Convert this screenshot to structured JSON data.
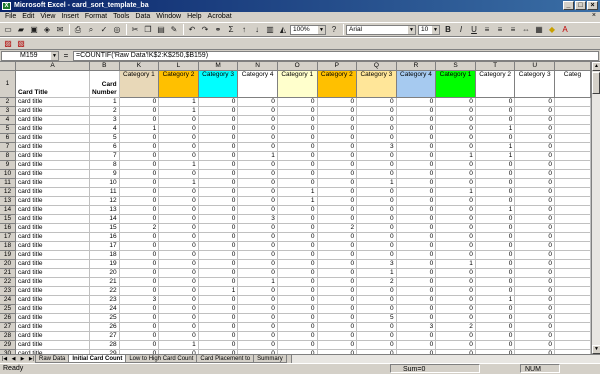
{
  "window": {
    "title": "Microsoft Excel - card_sort_template_ba"
  },
  "menu": [
    "File",
    "Edit",
    "View",
    "Insert",
    "Format",
    "Tools",
    "Data",
    "Window",
    "Help",
    "Acrobat"
  ],
  "toolbar": {
    "zoom": "100%",
    "font": "Arial",
    "font_size": "10"
  },
  "formula_bar": {
    "name_box": "M159",
    "formula": "=COUNTIF('Raw Data'!K$2:K$250,$B159)"
  },
  "columns": [
    "A",
    "B",
    "K",
    "L",
    "M",
    "N",
    "O",
    "P",
    "Q",
    "R",
    "S",
    "T",
    "U",
    ""
  ],
  "header_row": {
    "card_title": "Card Title",
    "card_number": "Card Number",
    "categories": [
      {
        "label": "Category 1",
        "color": "#e8d8b8"
      },
      {
        "label": "Category 2",
        "color": "#ffc000"
      },
      {
        "label": "Category 3",
        "color": "#00ffff"
      },
      {
        "label": "Category 4",
        "color": "#ffffff"
      },
      {
        "label": "Category 1",
        "color": "#ffffcc"
      },
      {
        "label": "Category 2",
        "color": "#ffc000"
      },
      {
        "label": "Category 3",
        "color": "#ffe699"
      },
      {
        "label": "Category 4",
        "color": "#a6caf0"
      },
      {
        "label": "Category 1",
        "color": "#00ff00"
      },
      {
        "label": "Category 2",
        "color": "#ffffff"
      },
      {
        "label": "Category 3",
        "color": "#ffffff"
      },
      {
        "label": "Categ",
        "color": "#ffffff"
      }
    ]
  },
  "rows": [
    {
      "n": "2",
      "title": "card title",
      "num": "1",
      "v": [
        "0",
        "1",
        "0",
        "0",
        "0",
        "0",
        "0",
        "0",
        "0",
        "0",
        "0",
        ""
      ]
    },
    {
      "n": "3",
      "title": "card title",
      "num": "2",
      "v": [
        "0",
        "1",
        "0",
        "0",
        "0",
        "0",
        "0",
        "0",
        "0",
        "0",
        "0",
        ""
      ]
    },
    {
      "n": "4",
      "title": "card title",
      "num": "3",
      "v": [
        "0",
        "0",
        "0",
        "0",
        "0",
        "0",
        "0",
        "0",
        "0",
        "0",
        "0",
        ""
      ]
    },
    {
      "n": "5",
      "title": "card title",
      "num": "4",
      "v": [
        "1",
        "0",
        "0",
        "0",
        "0",
        "0",
        "0",
        "0",
        "0",
        "1",
        "0",
        ""
      ]
    },
    {
      "n": "6",
      "title": "card title",
      "num": "5",
      "v": [
        "0",
        "0",
        "0",
        "0",
        "0",
        "0",
        "0",
        "0",
        "0",
        "0",
        "0",
        ""
      ]
    },
    {
      "n": "7",
      "title": "card title",
      "num": "6",
      "v": [
        "0",
        "0",
        "0",
        "0",
        "0",
        "0",
        "3",
        "0",
        "0",
        "1",
        "0",
        ""
      ]
    },
    {
      "n": "8",
      "title": "card title",
      "num": "7",
      "v": [
        "0",
        "0",
        "0",
        "1",
        "0",
        "0",
        "0",
        "0",
        "1",
        "1",
        "0",
        ""
      ]
    },
    {
      "n": "9",
      "title": "card title",
      "num": "8",
      "v": [
        "0",
        "1",
        "0",
        "0",
        "0",
        "0",
        "0",
        "0",
        "0",
        "0",
        "0",
        ""
      ]
    },
    {
      "n": "10",
      "title": "card title",
      "num": "9",
      "v": [
        "0",
        "0",
        "0",
        "0",
        "0",
        "0",
        "0",
        "0",
        "0",
        "0",
        "0",
        ""
      ]
    },
    {
      "n": "11",
      "title": "card title",
      "num": "10",
      "v": [
        "0",
        "1",
        "0",
        "0",
        "0",
        "0",
        "1",
        "0",
        "0",
        "0",
        "0",
        ""
      ]
    },
    {
      "n": "12",
      "title": "card title",
      "num": "11",
      "v": [
        "0",
        "0",
        "0",
        "0",
        "1",
        "0",
        "0",
        "0",
        "1",
        "0",
        "0",
        ""
      ]
    },
    {
      "n": "13",
      "title": "card title",
      "num": "12",
      "v": [
        "0",
        "0",
        "0",
        "0",
        "1",
        "0",
        "0",
        "0",
        "0",
        "0",
        "0",
        ""
      ]
    },
    {
      "n": "14",
      "title": "card title",
      "num": "13",
      "v": [
        "0",
        "0",
        "0",
        "0",
        "0",
        "0",
        "0",
        "0",
        "0",
        "1",
        "0",
        ""
      ]
    },
    {
      "n": "15",
      "title": "card title",
      "num": "14",
      "v": [
        "0",
        "0",
        "0",
        "3",
        "0",
        "0",
        "0",
        "0",
        "0",
        "0",
        "0",
        ""
      ]
    },
    {
      "n": "16",
      "title": "card title",
      "num": "15",
      "v": [
        "2",
        "0",
        "0",
        "0",
        "0",
        "2",
        "0",
        "0",
        "0",
        "0",
        "0",
        ""
      ]
    },
    {
      "n": "17",
      "title": "card title",
      "num": "16",
      "v": [
        "0",
        "0",
        "0",
        "0",
        "0",
        "0",
        "0",
        "0",
        "0",
        "0",
        "0",
        ""
      ]
    },
    {
      "n": "18",
      "title": "card title",
      "num": "17",
      "v": [
        "0",
        "0",
        "0",
        "0",
        "0",
        "0",
        "0",
        "0",
        "0",
        "0",
        "0",
        ""
      ]
    },
    {
      "n": "19",
      "title": "card title",
      "num": "18",
      "v": [
        "0",
        "0",
        "0",
        "0",
        "0",
        "0",
        "0",
        "0",
        "0",
        "0",
        "0",
        ""
      ]
    },
    {
      "n": "20",
      "title": "card title",
      "num": "19",
      "v": [
        "0",
        "0",
        "0",
        "0",
        "0",
        "0",
        "3",
        "0",
        "1",
        "0",
        "0",
        ""
      ]
    },
    {
      "n": "21",
      "title": "card title",
      "num": "20",
      "v": [
        "0",
        "0",
        "0",
        "0",
        "0",
        "0",
        "1",
        "0",
        "0",
        "0",
        "0",
        ""
      ]
    },
    {
      "n": "22",
      "title": "card title",
      "num": "21",
      "v": [
        "0",
        "0",
        "0",
        "1",
        "0",
        "0",
        "2",
        "0",
        "0",
        "0",
        "0",
        ""
      ]
    },
    {
      "n": "23",
      "title": "card title",
      "num": "22",
      "v": [
        "0",
        "0",
        "1",
        "0",
        "0",
        "0",
        "0",
        "0",
        "0",
        "0",
        "0",
        ""
      ]
    },
    {
      "n": "24",
      "title": "card title",
      "num": "23",
      "v": [
        "3",
        "0",
        "0",
        "0",
        "0",
        "0",
        "0",
        "0",
        "0",
        "1",
        "0",
        ""
      ]
    },
    {
      "n": "25",
      "title": "card title",
      "num": "24",
      "v": [
        "0",
        "0",
        "0",
        "0",
        "0",
        "0",
        "0",
        "0",
        "0",
        "0",
        "0",
        ""
      ]
    },
    {
      "n": "26",
      "title": "card title",
      "num": "25",
      "v": [
        "0",
        "0",
        "0",
        "0",
        "0",
        "0",
        "5",
        "0",
        "0",
        "0",
        "0",
        ""
      ]
    },
    {
      "n": "27",
      "title": "card title",
      "num": "26",
      "v": [
        "0",
        "0",
        "0",
        "0",
        "0",
        "0",
        "0",
        "3",
        "2",
        "0",
        "0",
        ""
      ]
    },
    {
      "n": "28",
      "title": "card title",
      "num": "27",
      "v": [
        "0",
        "0",
        "0",
        "0",
        "0",
        "0",
        "0",
        "0",
        "0",
        "0",
        "0",
        ""
      ]
    },
    {
      "n": "29",
      "title": "card title",
      "num": "28",
      "v": [
        "0",
        "1",
        "0",
        "0",
        "0",
        "0",
        "0",
        "0",
        "0",
        "0",
        "0",
        ""
      ]
    },
    {
      "n": "30",
      "title": "card title",
      "num": "29",
      "v": [
        "0",
        "0",
        "0",
        "0",
        "0",
        "0",
        "0",
        "0",
        "0",
        "0",
        "0",
        ""
      ]
    }
  ],
  "sheet_tabs": [
    {
      "label": "Raw Data",
      "active": false
    },
    {
      "label": "Initial Card Count",
      "active": true
    },
    {
      "label": "Low to High Card Count",
      "active": false
    },
    {
      "label": "Card Placement to",
      "active": false
    },
    {
      "label": "Summary",
      "active": false
    }
  ],
  "status": {
    "ready": "Ready",
    "sum": "Sum=0",
    "mode": "NUM"
  },
  "icons": [
    "new-icon",
    "open-icon",
    "save-icon",
    "permission-icon",
    "email-icon",
    "print-icon",
    "preview-icon",
    "spelling-icon",
    "research-icon",
    "cut-icon",
    "copy-icon",
    "paste-icon",
    "format-painter-icon",
    "undo-icon",
    "redo-icon",
    "hyperlink-icon",
    "autosum-icon",
    "sort-asc-icon",
    "sort-desc-icon",
    "chart-wizard-icon",
    "drawing-icon"
  ]
}
